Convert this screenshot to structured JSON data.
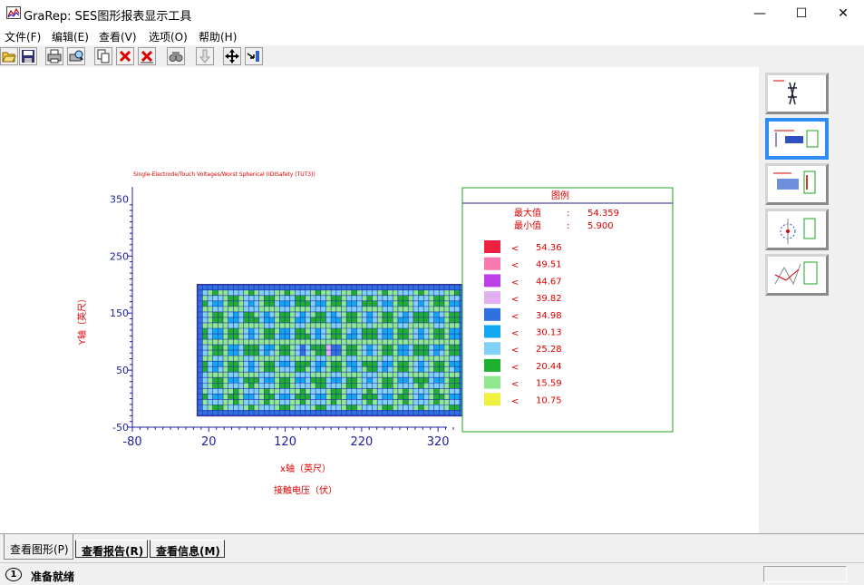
{
  "window": {
    "title": "GraRep: SES图形报表显示工具",
    "minimize": "—",
    "maximize": "☐",
    "close": "✕"
  },
  "menu": [
    "文件(F)",
    "编辑(E)",
    "查看(V)",
    "选项(O)",
    "帮助(H)"
  ],
  "toolbar": [
    "open-icon",
    "save-icon",
    "print-icon",
    "print-preview-icon",
    "copy-icon",
    "delete-icon",
    "delete-all-icon",
    "find-icon",
    "down-arrow-icon",
    "move-icon",
    "fit-icon"
  ],
  "chart_data": {
    "type": "heatmap",
    "title": "Single-Electrode/Touch Voltages/Worst Spherical (IDISafety (TUT3))",
    "xlabel": "x轴（英尺）",
    "ylabel": "Y轴（英尺）",
    "caption": "接触电压（伏）",
    "xticks": [
      "-80",
      "20",
      "120",
      "220",
      "320"
    ],
    "yticks": [
      "350",
      "250",
      "150",
      "50",
      "-50"
    ],
    "xlim": [
      -80,
      340
    ],
    "ylim": [
      -50,
      400
    ],
    "grid_extent": {
      "x": [
        5,
        355
      ],
      "y": [
        -30,
        200
      ]
    },
    "legend": {
      "title": "图例",
      "max_label": "最大值",
      "max_value": "54.359",
      "min_label": "最小值",
      "min_value": "5.900",
      "sep": ":",
      "arrow": "<",
      "entries": [
        {
          "color": "#f02040",
          "value": "54.36"
        },
        {
          "color": "#f878b0",
          "value": "49.51"
        },
        {
          "color": "#c040e8",
          "value": "44.67"
        },
        {
          "color": "#e0b0f0",
          "value": "39.82"
        },
        {
          "color": "#3070e0",
          "value": "34.98"
        },
        {
          "color": "#10a8f0",
          "value": "30.13"
        },
        {
          "color": "#80d0f8",
          "value": "25.28"
        },
        {
          "color": "#20b030",
          "value": "20.44"
        },
        {
          "color": "#90e890",
          "value": "15.59"
        },
        {
          "color": "#f0f040",
          "value": "10.75"
        }
      ]
    }
  },
  "tabs": [
    "查看图形(P)",
    "查看报告(R)",
    "查看信息(M)"
  ],
  "status": {
    "icon": "1",
    "text": "准备就绪"
  }
}
